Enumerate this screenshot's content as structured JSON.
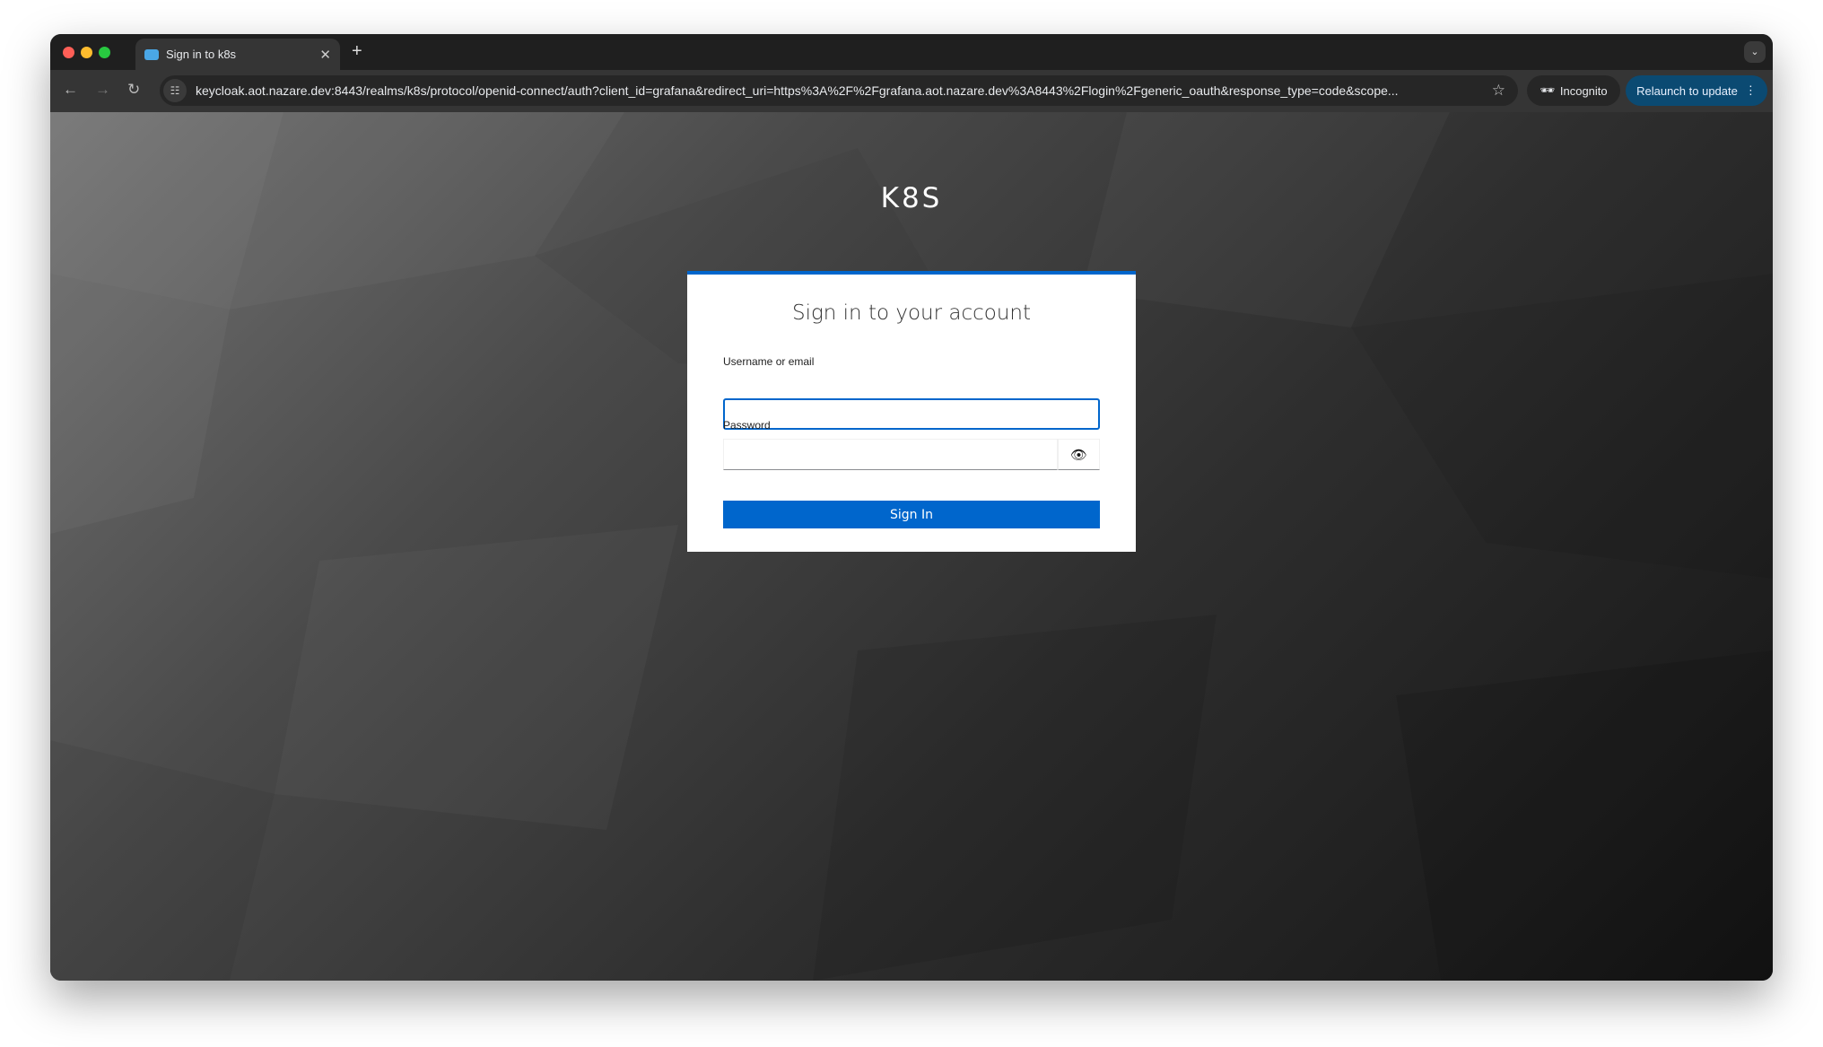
{
  "browser": {
    "tab_title": "Sign in to k8s",
    "url": "keycloak.aot.nazare.dev:8443/realms/k8s/protocol/openid-connect/auth?client_id=grafana&redirect_uri=https%3A%2F%2Fgrafana.aot.nazare.dev%3A8443%2Flogin%2Fgeneric_oauth&response_type=code&scope...",
    "incognito_label": "Incognito",
    "relaunch_label": "Relaunch to update"
  },
  "page": {
    "realm_name": "K8S",
    "title": "Sign in to your account",
    "username_label": "Username or email",
    "username_value": "",
    "password_label": "Password",
    "password_value": "",
    "sign_in_label": "Sign In"
  },
  "colors": {
    "accent": "#0066cc",
    "relaunch": "#0b4a72"
  }
}
